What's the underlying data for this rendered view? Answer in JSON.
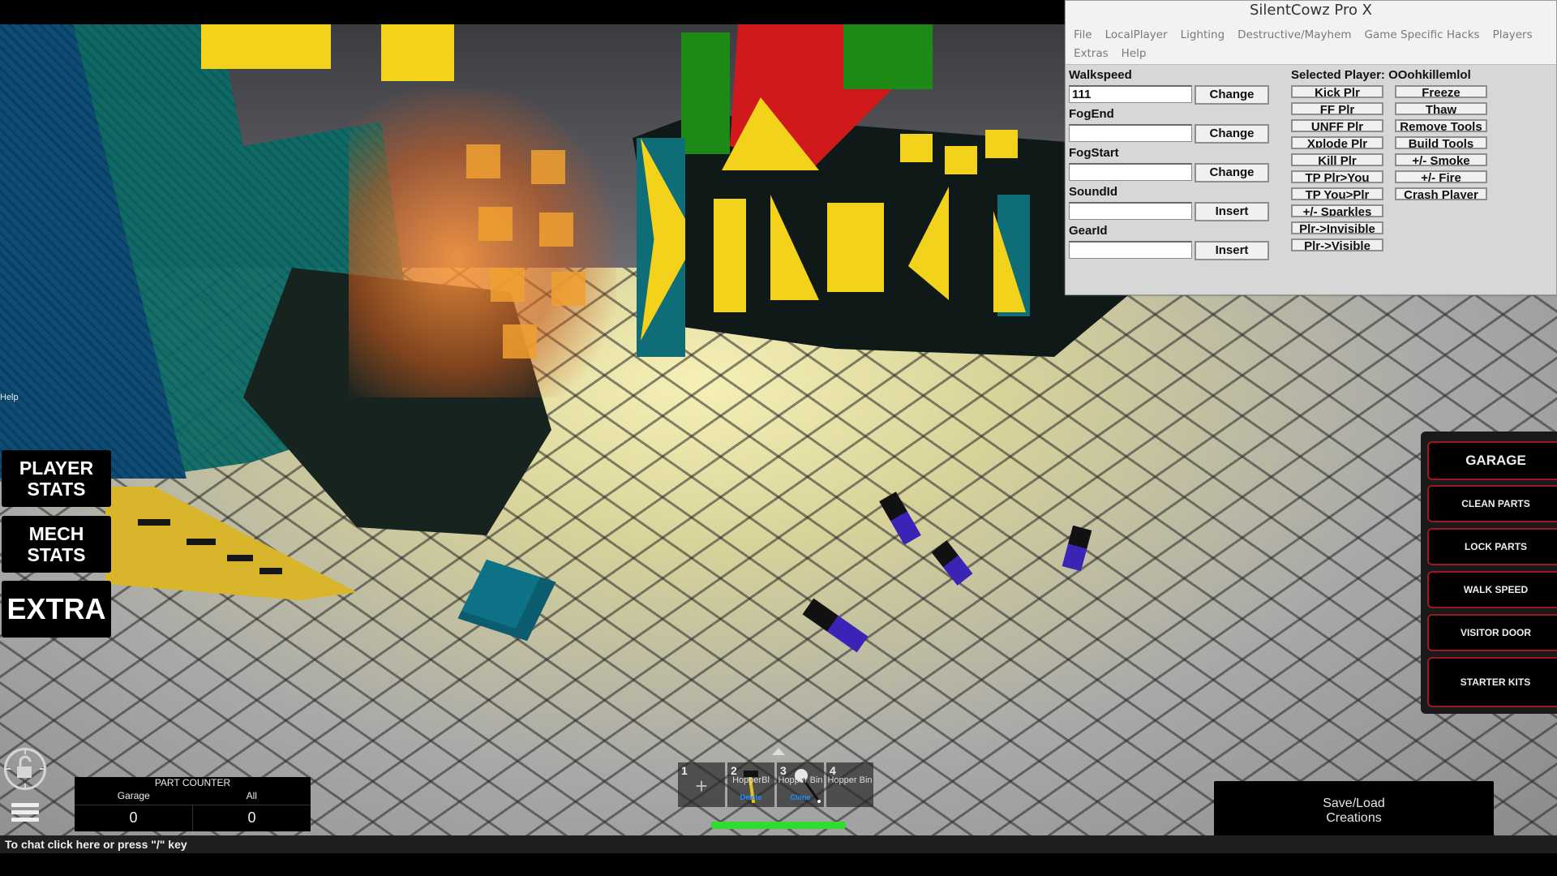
{
  "hack_window": {
    "title": "SilentCowz Pro X",
    "menu_row1": [
      "File",
      "LocalPlayer",
      "Lighting",
      "Destructive/Mayhem",
      "Game Specific Hacks",
      "Players"
    ],
    "menu_row2": [
      "Extras",
      "Help"
    ],
    "fields": [
      {
        "label": "Walkspeed",
        "value": "111",
        "button": "Change"
      },
      {
        "label": "FogEnd",
        "value": "",
        "button": "Change"
      },
      {
        "label": "FogStart",
        "value": "",
        "button": "Change"
      },
      {
        "label": "SoundId",
        "value": "",
        "button": "Insert"
      },
      {
        "label": "GearId",
        "value": "",
        "button": "Insert"
      }
    ],
    "selected_player_label": "Selected Player: OOohkillemlol",
    "player_buttons_col1": [
      "Kick Plr",
      "FF Plr",
      "UNFF Plr",
      "Xplode Plr",
      "Kill Plr",
      "TP Plr>You",
      "TP You>Plr",
      "+/- Sparkles",
      "Plr->Invisible",
      "Plr->Visible"
    ],
    "player_buttons_col2": [
      "Freeze",
      "Thaw",
      "Remove Tools",
      "Build Tools",
      "+/- Smoke",
      "+/- Fire",
      "Crash Player"
    ]
  },
  "left_hud": {
    "help": "Help",
    "player_stats": [
      "PLAYER",
      "STATS"
    ],
    "mech_stats": [
      "MECH",
      "STATS"
    ],
    "extra": "EXTRA"
  },
  "right_menu": {
    "items": [
      "GARAGE",
      "CLEAN PARTS",
      "LOCK PARTS",
      "WALK SPEED",
      "VISITOR DOOR",
      "STARTER KITS"
    ]
  },
  "part_counter": {
    "title": "PART COUNTER",
    "headers": [
      "Garage",
      "All"
    ],
    "values": [
      "0",
      "0"
    ]
  },
  "hotbar": {
    "slots": [
      {
        "num": "1",
        "name": "",
        "sub": "",
        "icon": "plus-icon"
      },
      {
        "num": "2",
        "name": "HopperBl",
        "sub": "Delete",
        "icon": "hammer-icon"
      },
      {
        "num": "3",
        "name": "Hopper Bin",
        "sub": "Clone",
        "icon": "wand-icon"
      },
      {
        "num": "4",
        "name": "Hopper Bin",
        "sub": "",
        "icon": ""
      }
    ],
    "health_fraction": 1.0
  },
  "save_load": [
    "Save/Load",
    "Creations"
  ],
  "chat_hint": "To chat click here or press \"/\" key",
  "colors": {
    "accent_red": "#9b1a1f",
    "health_green": "#2fdc2f",
    "window_bg": "#d7d7d7"
  }
}
